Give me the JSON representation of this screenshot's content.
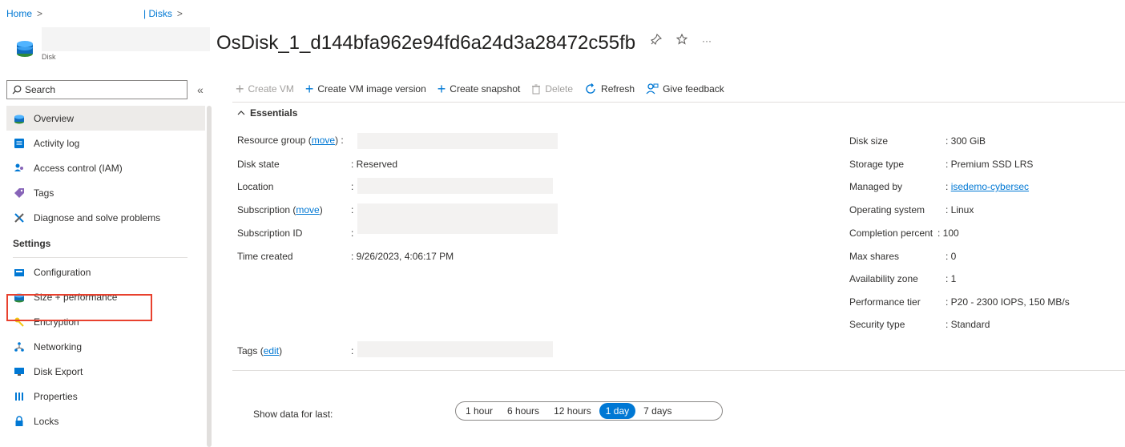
{
  "breadcrumb": {
    "home": "Home",
    "separator": ">",
    "disks": "| Disks"
  },
  "header": {
    "title": "OsDisk_1_d144bfa962e94fd6a24d3a28472c55fb",
    "resource_type": "Disk",
    "pin_icon": "pin-icon",
    "star_icon": "star-icon",
    "more_icon": "ellipsis-icon"
  },
  "sidebar": {
    "search_placeholder": "Search",
    "collapse_glyph": "«",
    "items": [
      {
        "label": "Overview",
        "icon": "disk-icon",
        "active": true
      },
      {
        "label": "Activity log",
        "icon": "activity-log-icon"
      },
      {
        "label": "Access control (IAM)",
        "icon": "iam-icon"
      },
      {
        "label": "Tags",
        "icon": "tag-icon"
      },
      {
        "label": "Diagnose and solve problems",
        "icon": "wrench-icon"
      }
    ],
    "settings_label": "Settings",
    "settings_items": [
      {
        "label": "Configuration",
        "icon": "configuration-icon"
      },
      {
        "label": "Size + performance",
        "icon": "disk-icon",
        "highlighted": true
      },
      {
        "label": "Encryption",
        "icon": "key-icon"
      },
      {
        "label": "Networking",
        "icon": "networking-icon"
      },
      {
        "label": "Disk Export",
        "icon": "monitor-icon"
      },
      {
        "label": "Properties",
        "icon": "properties-icon"
      },
      {
        "label": "Locks",
        "icon": "lock-icon"
      }
    ]
  },
  "toolbar": {
    "create_vm": "Create VM",
    "create_vm_image_version": "Create VM image version",
    "create_snapshot": "Create snapshot",
    "delete": "Delete",
    "refresh": "Refresh",
    "give_feedback": "Give feedback"
  },
  "essentials": {
    "toggle_label": "Essentials",
    "left": {
      "resource_group_label": "Resource group",
      "resource_group_link": "move",
      "disk_state_label": "Disk state",
      "disk_state_value": ": Reserved",
      "location_label": "Location",
      "subscription_label": "Subscription",
      "subscription_link": "move",
      "subscription_id_label": "Subscription ID",
      "time_created_label": "Time created",
      "time_created_value": ": 9/26/2023, 4:06:17 PM",
      "tags_label": "Tags",
      "tags_link": "edit",
      "colon": ":"
    },
    "right": {
      "disk_size_label": "Disk size",
      "disk_size_value": ": 300 GiB",
      "storage_type_label": "Storage type",
      "storage_type_value": ": Premium SSD LRS",
      "managed_by_label": "Managed by",
      "managed_by_value": "isedemo-cybersec",
      "operating_system_label": "Operating system",
      "operating_system_value": ": Linux",
      "completion_percent_label": "Completion percent",
      "completion_percent_value": ": 100",
      "max_shares_label": "Max shares",
      "max_shares_value": ": 0",
      "availability_zone_label": "Availability zone",
      "availability_zone_value": ": 1",
      "performance_tier_label": "Performance tier",
      "performance_tier_value": ": P20 - 2300 IOPS, 150 MB/s",
      "security_type_label": "Security type",
      "security_type_value": ": Standard"
    }
  },
  "time_range": {
    "label": "Show data for last:",
    "options": [
      "1 hour",
      "6 hours",
      "12 hours",
      "1 day",
      "7 days"
    ],
    "selected": "1 day"
  },
  "colors": {
    "accent": "#0078d4",
    "highlight": "#e8412e"
  }
}
